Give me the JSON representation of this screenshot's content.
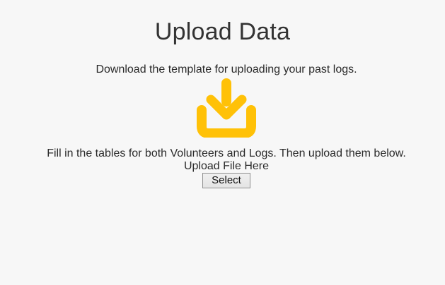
{
  "page": {
    "title": "Upload Data",
    "template_note": "Download the template for uploading your past logs.",
    "download_icon": "download-icon",
    "accent_color": "#ffc107",
    "instructions": "Fill in the tables for both Volunteers and Logs. Then upload them below.",
    "upload_label": "Upload File Here",
    "select_button_label": "Select"
  }
}
